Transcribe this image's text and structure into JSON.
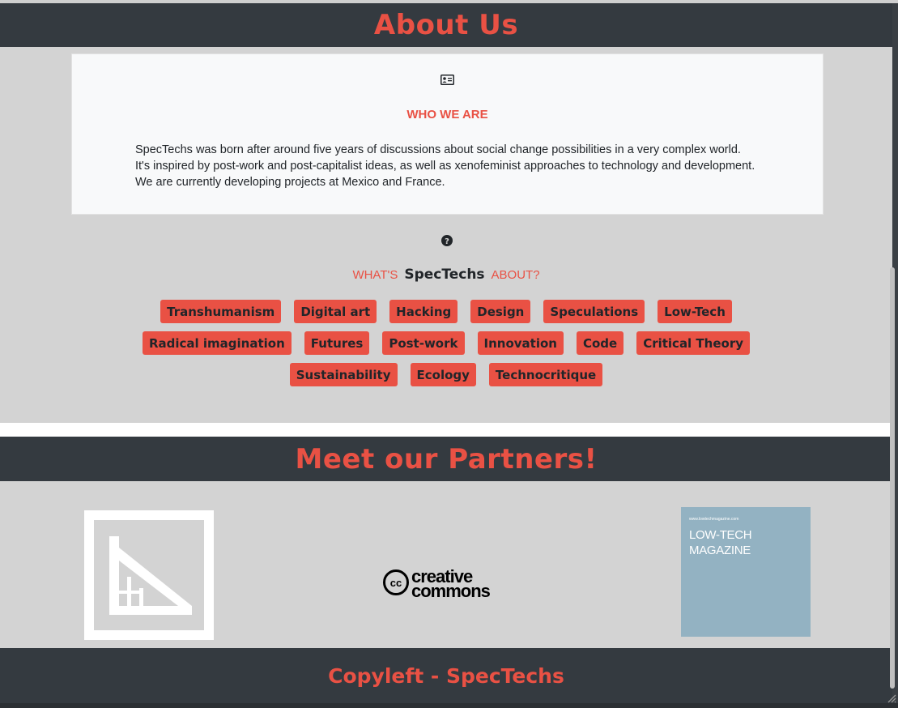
{
  "about": {
    "heading": "About Us",
    "card": {
      "icon": "id-card-icon",
      "title": "WHO WE ARE",
      "lines": [
        "SpecTechs was born after around five years of discussions about social change possibilities in a very complex world.",
        "It's inspired by post-work and post-capitalist ideas, as well as xenofeminist approaches to technology and development.",
        "We are currently developing projects at Mexico and France."
      ]
    },
    "question_icon": "question-circle-icon",
    "whats_prefix": "WHAT'S",
    "brand": "SpecTechs",
    "whats_suffix": "ABOUT?",
    "tags": [
      [
        "Transhumanism",
        "Digital art",
        "Hacking",
        "Design",
        "Speculations",
        "Low-Tech"
      ],
      [
        "Radical imagination",
        "Futures",
        "Post-work",
        "Innovation",
        "Code",
        "Critical Theory"
      ],
      [
        "Sustainability",
        "Ecology",
        "Technocritique"
      ]
    ]
  },
  "partners": {
    "heading": "Meet our Partners!",
    "logos": [
      {
        "name": "set-square-logo"
      },
      {
        "name": "creative-commons-logo",
        "text_line1": "creative",
        "text_line2": "commons",
        "cc": "cc"
      },
      {
        "name": "low-tech-magazine-logo",
        "url": "www.lowtechmagazine.com",
        "line1": "LOW-TECH",
        "line2": "MAGAZINE"
      }
    ]
  },
  "footer": {
    "text": "Copyleft - SpecTechs"
  },
  "colors": {
    "accent": "#e95144",
    "dark_bar": "#343a40",
    "background": "#d3d3d3",
    "card": "#f8f9fa"
  }
}
